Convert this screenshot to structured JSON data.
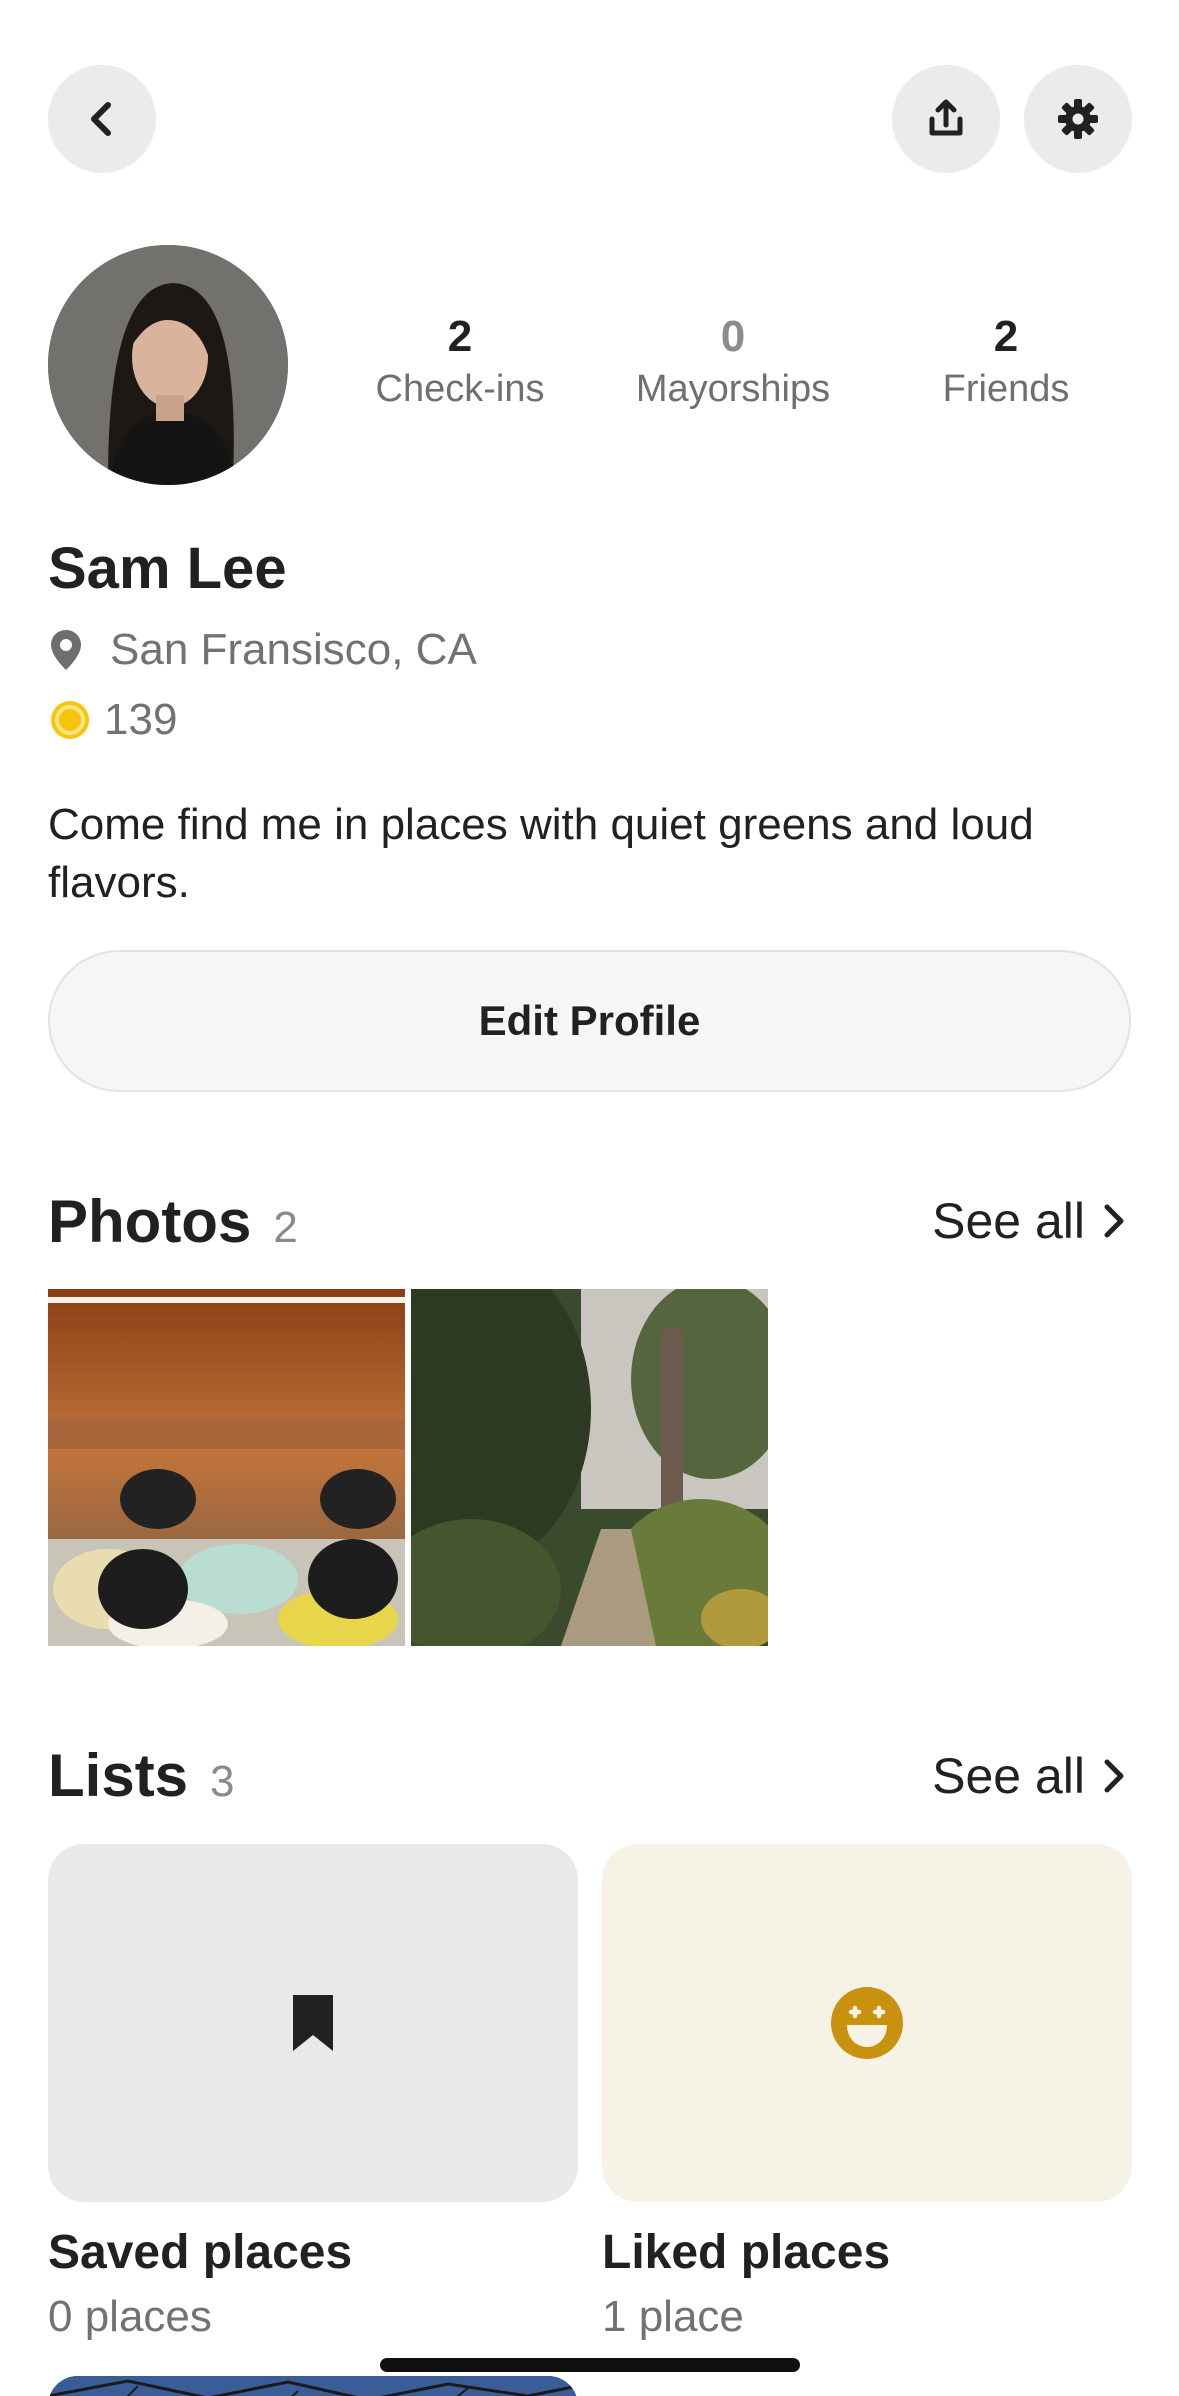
{
  "header": {
    "back_icon": "chevron-left-icon",
    "share_icon": "share-icon",
    "settings_icon": "gear-icon"
  },
  "profile": {
    "name": "Sam Lee",
    "location": "San Fransisco, CA",
    "coins": "139",
    "bio": "Come find me in places with quiet greens and loud flavors.",
    "edit_label": "Edit Profile"
  },
  "stats": [
    {
      "value": "2",
      "label": "Check-ins"
    },
    {
      "value": "0",
      "label": "Mayorships"
    },
    {
      "value": "2",
      "label": "Friends"
    }
  ],
  "photos": {
    "title": "Photos",
    "count": "2",
    "see_all": "See all"
  },
  "lists": {
    "title": "Lists",
    "count": "3",
    "see_all": "See all",
    "items": [
      {
        "name": "Saved places",
        "count": "0 places",
        "icon": "bookmark-icon"
      },
      {
        "name": "Liked places",
        "count": "1 place",
        "icon": "grin-face-icon"
      }
    ]
  },
  "colors": {
    "accent_gold": "#c8920f",
    "coin_yellow": "#f6c40a",
    "text_dark": "#1f2123",
    "text_muted": "#727272"
  }
}
